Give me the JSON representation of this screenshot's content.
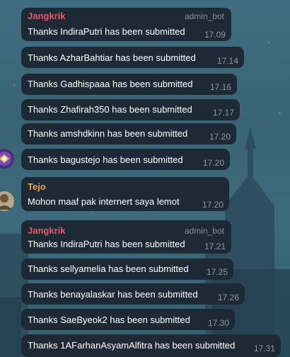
{
  "messages": [
    {
      "sender": "Jangkrik",
      "tag": "admin_bot",
      "text": "Thanks IndiraPutri has been submitted",
      "time": "17.09"
    },
    {
      "text": "Thanks AzharBahtiar has been submitted",
      "time": "17.14"
    },
    {
      "text": "Thanks Gadhispaaa has been submitted",
      "time": "17.16"
    },
    {
      "text": "Thanks Zhafirah350 has been submitted",
      "time": "17.17"
    },
    {
      "text": "Thanks amshdkinn has been submitted",
      "time": "17.20"
    },
    {
      "text": "Thanks bagustejo has been submitted",
      "time": "17.20"
    },
    {
      "sender": "Tejo",
      "text": "Mohon maaf pak internert saya lemot",
      "time": "17.20"
    },
    {
      "sender": "Jangkrik",
      "tag": "admin_bot",
      "text": "Thanks IndiraPutri has been submitted",
      "time": "17.21"
    },
    {
      "text": "Thanks sellyamelia has been submitted",
      "time": "17.25"
    },
    {
      "text": "Thanks benayalaskar has been submitted",
      "time": "17.26"
    },
    {
      "text": "Thanks SaeByeok2 has been submitted",
      "time": "17.30"
    },
    {
      "text": "Thanks 1AFarhanAsyamAlfitra has been submitted",
      "time": "17.31"
    }
  ],
  "colors": {
    "background": "#3d6a7c",
    "bubble": "#1d2a36",
    "sender_jangkrik": "#e8566a",
    "sender_tejo": "#f0a23a",
    "timestamp": "#8a98a6"
  },
  "icons": [
    "bot-avatar-icon",
    "tejo-avatar-icon"
  ]
}
